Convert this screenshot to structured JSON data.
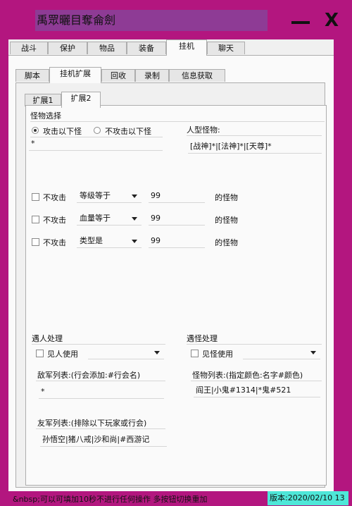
{
  "window": {
    "title": "禹眾曬目奪侖劍"
  },
  "colors": {
    "window_bg": "#b3167f",
    "title_field": "#8e3b95",
    "version_bg": "#4ee7d8"
  },
  "icons": {
    "minimize": "minimize-icon",
    "close": "close-icon"
  },
  "title_buttons": {
    "close": "X"
  },
  "main_tabs": [
    {
      "label": "战斗"
    },
    {
      "label": "保护"
    },
    {
      "label": "物品"
    },
    {
      "label": "装备"
    },
    {
      "label": "挂机"
    },
    {
      "label": "聊天"
    }
  ],
  "sub_tabs": [
    {
      "label": "脚本"
    },
    {
      "label": "挂机扩展"
    },
    {
      "label": "回收"
    },
    {
      "label": "录制"
    },
    {
      "label": "信息获取"
    }
  ],
  "ext_tabs": [
    {
      "label": "扩展1"
    },
    {
      "label": "扩展2"
    }
  ],
  "monster_select": {
    "section_label": "怪物选择",
    "radio_attack": "攻击以下怪",
    "radio_no_attack": "不攻击以下怪",
    "selected": "攻击以下怪",
    "list_value": "*",
    "humanoid_label": "人型怪物:",
    "humanoid_value": "[战神]*|[法神]*|[天尊]*"
  },
  "filters": [
    {
      "checkbox_label": "不攻击",
      "select_value": "等级等于",
      "input_value": "99",
      "suffix": "的怪物"
    },
    {
      "checkbox_label": "不攻击",
      "select_value": "血量等于",
      "input_value": "99",
      "suffix": "的怪物"
    },
    {
      "checkbox_label": "不攻击",
      "select_value": "类型是",
      "input_value": "99",
      "suffix": "的怪物"
    }
  ],
  "player_handling": {
    "section_label": "遇人处理",
    "checkbox_label": "见人使用",
    "enemy_label": "敌军列表:(行会添加:#行会名)",
    "enemy_value": "*",
    "friend_label": "友军列表:(排除以下玩家或行会)",
    "friend_value": "孙悟空|猪八戒|沙和尚|#西游记"
  },
  "monster_handling": {
    "section_label": "遇怪处理",
    "checkbox_label": "见怪使用",
    "list_label": "怪物列表:(指定颜色:名字#颜色)",
    "list_value": "阎王|小鬼#1314|*鬼#521"
  },
  "status": {
    "text": "&nbsp;可以可填加10秒不进行任何操作 多按钮切换重加",
    "version": "版本:2020/02/10 13"
  }
}
